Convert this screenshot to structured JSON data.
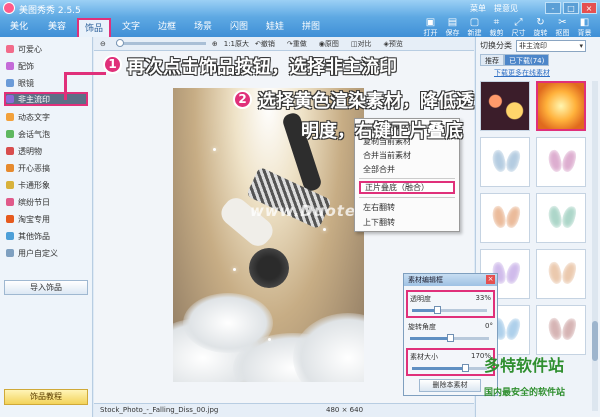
{
  "window": {
    "title": "美图秀秀 2.5.5",
    "links": [
      "菜单",
      "提意见",
      "—"
    ],
    "buttons": [
      "-",
      "□",
      "×"
    ]
  },
  "tabs": [
    "美化",
    "美容",
    "饰品",
    "文字",
    "边框",
    "场景",
    "闪图",
    "娃娃",
    "拼图"
  ],
  "active_tab": "饰品",
  "toolbar_icons": [
    {
      "label": "打开",
      "icon": "folder-icon"
    },
    {
      "label": "保存",
      "icon": "save-icon"
    },
    {
      "label": "新建",
      "icon": "new-icon"
    },
    {
      "label": "裁剪",
      "icon": "crop-icon"
    },
    {
      "label": "尺寸",
      "icon": "resize-icon"
    },
    {
      "label": "旋转",
      "icon": "rotate-icon"
    },
    {
      "label": "抠图",
      "icon": "cutout-icon"
    },
    {
      "label": "背景",
      "icon": "background-icon"
    }
  ],
  "sidebar": {
    "items": [
      {
        "label": "可爱心",
        "color": "#f26b8a"
      },
      {
        "label": "配饰",
        "color": "#c46bd8"
      },
      {
        "label": "眼镜",
        "color": "#6b9bd8"
      },
      {
        "label": "非主流印",
        "color": "#8b6bd8"
      },
      {
        "label": "动态文字",
        "color": "#f2a13b"
      },
      {
        "label": "会话气泡",
        "color": "#5fb85f"
      },
      {
        "label": "透明物",
        "color": "#d84d4d"
      },
      {
        "label": "开心恶搞",
        "color": "#e68a2e"
      },
      {
        "label": "卡通形象",
        "color": "#d8b23b"
      },
      {
        "label": "缤纷节日",
        "color": "#e05a8a"
      },
      {
        "label": "淘宝专用",
        "color": "#e65a1e"
      },
      {
        "label": "其他饰品",
        "color": "#4d9fd8"
      },
      {
        "label": "用户自定义",
        "color": "#7fa0c0"
      }
    ],
    "active_index": 3,
    "import_label": "导入饰品",
    "tutorial_label": "饰品教程"
  },
  "subtoolbar": {
    "zoom_label": "1:1原大",
    "actions": [
      "撤销",
      "重做",
      "原图",
      "对比",
      "预览"
    ]
  },
  "canvas": {
    "watermark": "www.Duote.com"
  },
  "context_menu": {
    "items": [
      "编辑当前素材",
      "复制当前素材",
      "合并当前素材",
      "全部合并",
      "正片叠底（融合）",
      "左右翻转",
      "上下翻转"
    ],
    "highlighted_index": 4
  },
  "material_dialog": {
    "title": "素材编辑框",
    "rows": [
      {
        "label": "透明度",
        "value": "33%",
        "level": 0.33
      },
      {
        "label": "旋转角度",
        "value": "0°",
        "level": 0.5
      },
      {
        "label": "素材大小",
        "value": "170%",
        "level": 0.7
      }
    ],
    "delete_label": "删除本素材"
  },
  "right_panel": {
    "category_label": "切换分类",
    "category_value": "非主流印",
    "tabs": [
      "推荐",
      "已下载(74)"
    ],
    "active_tab_index": 1,
    "link": "下载更多在线素材"
  },
  "status_bar": {
    "filename": "Stock_Photo_-_Falling_Diss_00.jpg",
    "dimensions": "480 × 640"
  },
  "annotations": {
    "step1_number": "1",
    "step1_text": "再次点击饰品按钮，选择非主流印",
    "step2_number": "2",
    "step2_line1": "选择黄色渲染素材，降低透",
    "step2_line2": "明度，右键正片叠底"
  },
  "site_logo": {
    "name": "多特软件站",
    "tagline": "国内最安全的软件站"
  },
  "colors": {
    "highlight": "#e0307a",
    "title_bar": "#5ea9e3",
    "active_sidebar": "#5d6f86"
  }
}
